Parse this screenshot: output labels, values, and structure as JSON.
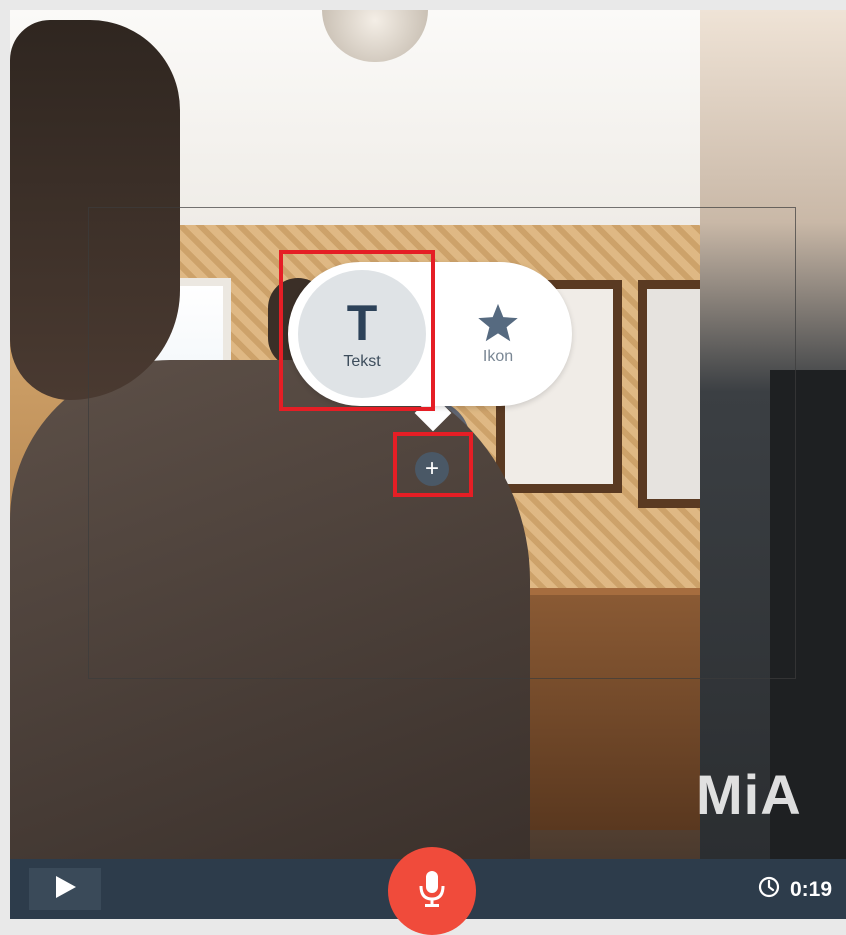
{
  "menu": {
    "text_option": {
      "glyph": "T",
      "label": "Tekst"
    },
    "icon_option": {
      "icon": "star-icon",
      "label": "Ikon"
    },
    "add_button": "+"
  },
  "watermark": "MiA",
  "controls": {
    "play_icon": "play-icon",
    "record_icon": "microphone-icon",
    "timer_icon": "clock-icon",
    "time": "0:19"
  },
  "colors": {
    "bar": "#2d3c4b",
    "record": "#f04b3b",
    "highlight": "#e51e25",
    "text_option_bg": "#dfe3e6",
    "glyph": "#2d4259"
  }
}
